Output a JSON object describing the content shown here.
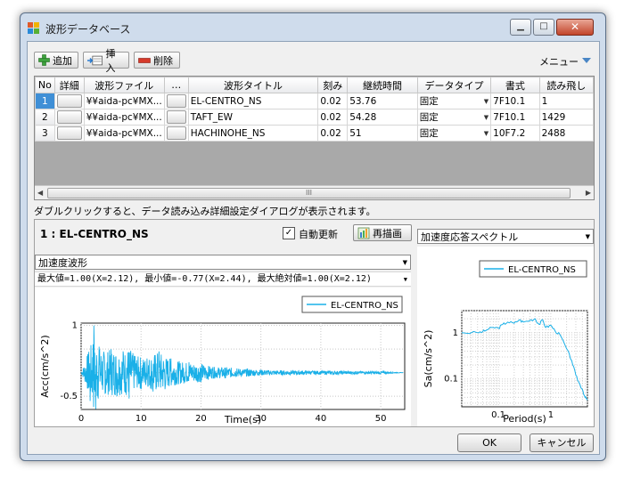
{
  "window": {
    "title": "波形データベース",
    "controls": [
      "▁",
      "□",
      "✕"
    ]
  },
  "toolbar": {
    "add_label": "追加",
    "insert_label": "挿入",
    "delete_label": "削除",
    "menu_label": "メニュー"
  },
  "grid": {
    "headers": [
      "No",
      "詳細",
      "波形ファイル",
      "…",
      "波形タイトル",
      "刻み",
      "継続時間",
      "データタイプ",
      "書式",
      "読み飛し"
    ],
    "rows": [
      {
        "no": "1",
        "file": "¥¥aida-pc¥MX...",
        "title": "EL-CENTRO_NS",
        "step": "0.02",
        "duration": "53.76",
        "type": "固定",
        "format": "7F10.1",
        "skip": "1"
      },
      {
        "no": "2",
        "file": "¥¥aida-pc¥MX...",
        "title": "TAFT_EW",
        "step": "0.02",
        "duration": "54.28",
        "type": "固定",
        "format": "7F10.1",
        "skip": "1429"
      },
      {
        "no": "3",
        "file": "¥¥aida-pc¥MX...",
        "title": "HACHINOHE_NS",
        "step": "0.02",
        "duration": "51",
        "type": "固定",
        "format": "10F7.2",
        "skip": "2488"
      }
    ],
    "scroll_thumb": "III"
  },
  "hint": "ダブルクリックすると、データ読み込み詳細設定ダイアログが表示されます。",
  "detail": {
    "heading": "1 : EL-CENTRO_NS",
    "auto_update_label": "自動更新",
    "auto_update_checked": true,
    "redraw_label": "再描画",
    "left_combo": "加速度波形",
    "right_combo": "加速度応答スペクトル",
    "info": "最大値=1.00(X=2.12), 最小値=-0.77(X=2.44), 最大絶対値=1.00(X=2.12)"
  },
  "chart_data": [
    {
      "type": "line",
      "legend": [
        "EL-CENTRO_NS"
      ],
      "legend_position": "top-right",
      "xlabel": "Time(s)",
      "ylabel": "Acc(cm/s^2)",
      "xticks": [
        "0",
        "10",
        "20",
        "30",
        "40",
        "50"
      ],
      "yticks": [
        "1",
        "-0.5"
      ],
      "xlim": [
        0,
        54
      ],
      "ylim": [
        -0.78,
        1.05
      ],
      "grid": true,
      "color": "#1ab0e8",
      "series": [
        {
          "name": "EL-CENTRO_NS",
          "x": [
            0,
            1,
            1.5,
            2,
            2.12,
            2.3,
            2.44,
            3,
            4,
            5,
            6,
            7,
            8,
            9,
            10,
            11,
            12,
            13,
            14,
            15,
            16,
            18,
            20,
            22,
            24,
            26,
            28,
            30,
            34,
            38,
            42,
            46,
            50,
            53.76
          ],
          "y": [
            0.0,
            0.35,
            -0.6,
            0.6,
            1.0,
            -0.4,
            -0.77,
            0.55,
            -0.45,
            0.5,
            -0.5,
            0.45,
            -0.55,
            0.35,
            -0.35,
            0.3,
            -0.4,
            0.45,
            -0.35,
            0.3,
            -0.25,
            0.22,
            -0.2,
            0.12,
            -0.12,
            0.09,
            -0.08,
            0.06,
            -0.05,
            0.04,
            -0.04,
            0.03,
            -0.03,
            0.0
          ]
        }
      ]
    },
    {
      "type": "line",
      "legend": [
        "EL-CENTRO_NS"
      ],
      "legend_position": "top",
      "xlabel": "Period(s)",
      "ylabel": "Sa(cm/s^2)",
      "xscale": "log",
      "yscale": "log",
      "xticks": [
        "0.1",
        "1"
      ],
      "yticks": [
        "1",
        "0.1"
      ],
      "xlim": [
        0.02,
        5
      ],
      "ylim": [
        0.025,
        3
      ],
      "grid": true,
      "color": "#1ab0e8",
      "series": [
        {
          "name": "EL-CENTRO_NS",
          "x": [
            0.02,
            0.04,
            0.05,
            0.06,
            0.08,
            0.1,
            0.12,
            0.15,
            0.2,
            0.25,
            0.3,
            0.4,
            0.5,
            0.6,
            0.7,
            0.8,
            1.0,
            1.2,
            1.5,
            2.0,
            2.5,
            3.0,
            3.5,
            4.0,
            4.5,
            5.0
          ],
          "y": [
            1.0,
            1.0,
            1.05,
            1.15,
            1.3,
            1.25,
            1.5,
            1.7,
            1.6,
            1.9,
            1.7,
            1.85,
            2.0,
            1.5,
            1.9,
            1.3,
            1.45,
            1.1,
            0.9,
            0.45,
            0.25,
            0.12,
            0.08,
            0.06,
            0.04,
            0.035
          ]
        }
      ]
    }
  ],
  "footer": {
    "ok_label": "OK",
    "cancel_label": "キャンセル"
  }
}
